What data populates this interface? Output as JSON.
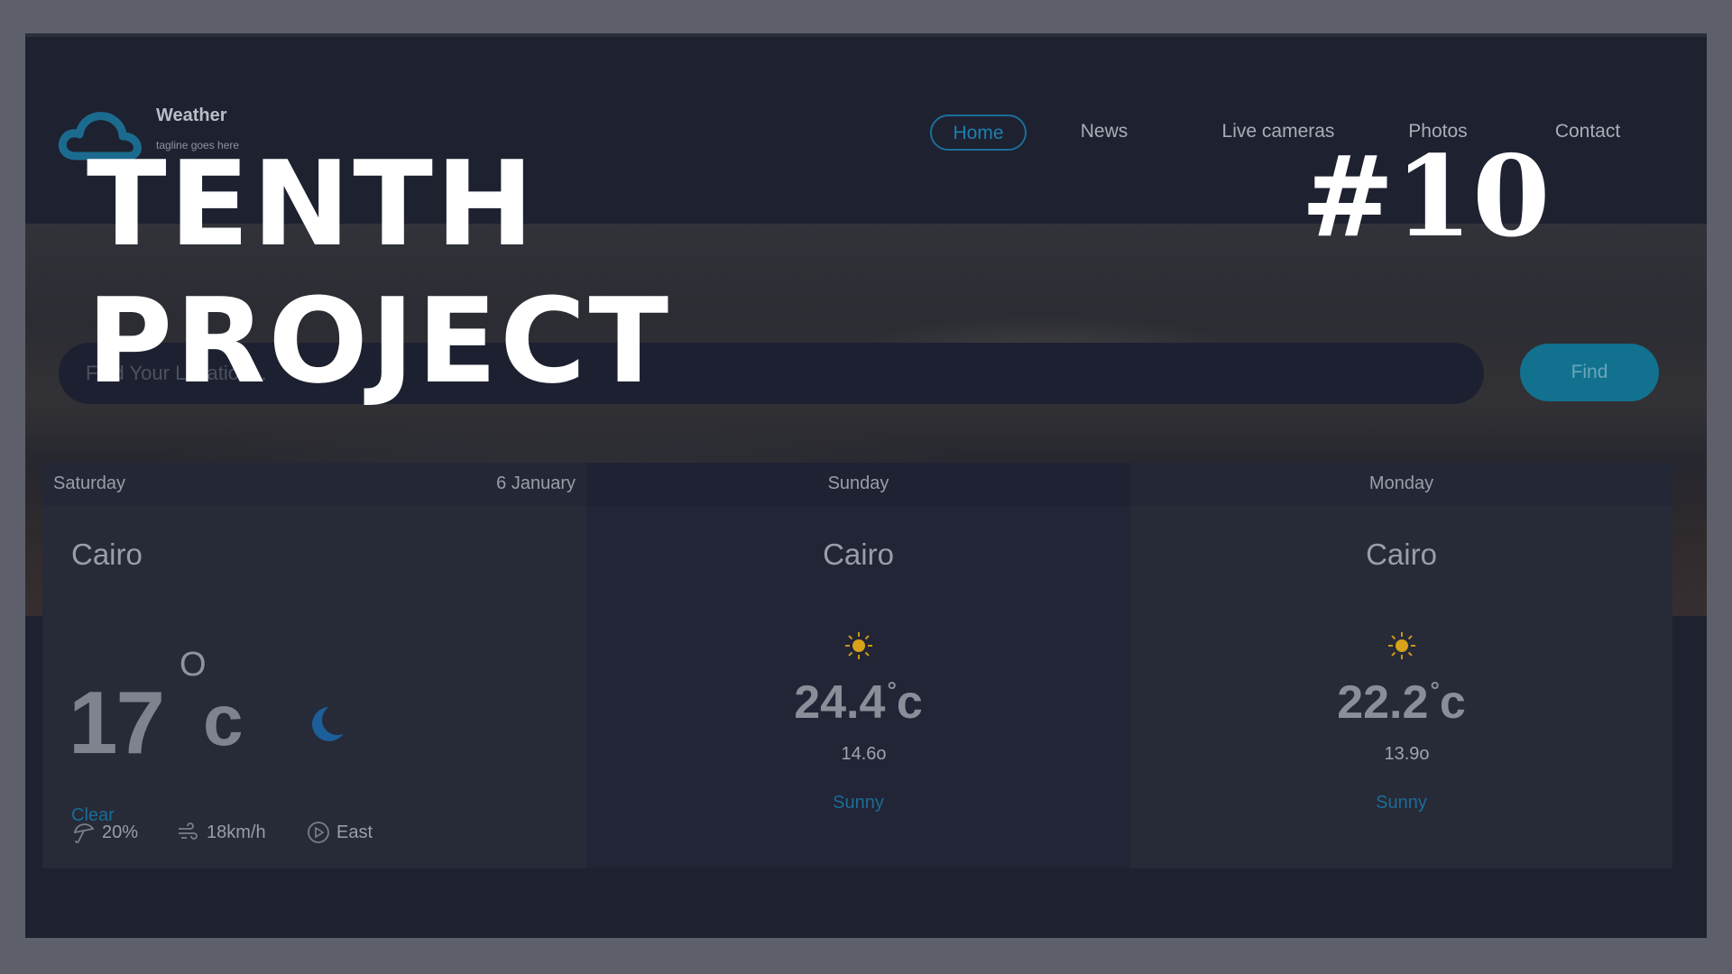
{
  "app": {
    "logo_title": "Weather",
    "tagline": "tagline goes here"
  },
  "nav": {
    "items": [
      {
        "label": "Home",
        "active": true
      },
      {
        "label": "News",
        "active": false
      },
      {
        "label": "Live cameras",
        "active": false
      },
      {
        "label": "Photos",
        "active": false
      },
      {
        "label": "Contact",
        "active": false
      }
    ]
  },
  "search": {
    "placeholder": "Find Your Location...",
    "button_label": "Find"
  },
  "forecast": {
    "today": {
      "day": "Saturday",
      "date": "6 January",
      "city": "Cairo",
      "temp": "17",
      "degree_symbol": "O",
      "unit": "c",
      "condition": "Clear",
      "condition_icon": "moon-icon",
      "humidity": "20%",
      "wind_speed": "18km/h",
      "wind_direction": "East"
    },
    "days": [
      {
        "day": "Sunday",
        "city": "Cairo",
        "max": "24.4",
        "unit": "c",
        "min": "14.6o",
        "condition": "Sunny",
        "icon": "sun-icon"
      },
      {
        "day": "Monday",
        "city": "Cairo",
        "max": "22.2",
        "unit": "c",
        "min": "13.9o",
        "condition": "Sunny",
        "icon": "sun-icon"
      }
    ]
  },
  "overlay": {
    "line1": "TENTH",
    "line2": "PROJECT",
    "number": "#10"
  },
  "colors": {
    "accent": "#1c7fb0",
    "background": "#1e2130",
    "card": "#272a37",
    "sun": "#d9a21b"
  }
}
